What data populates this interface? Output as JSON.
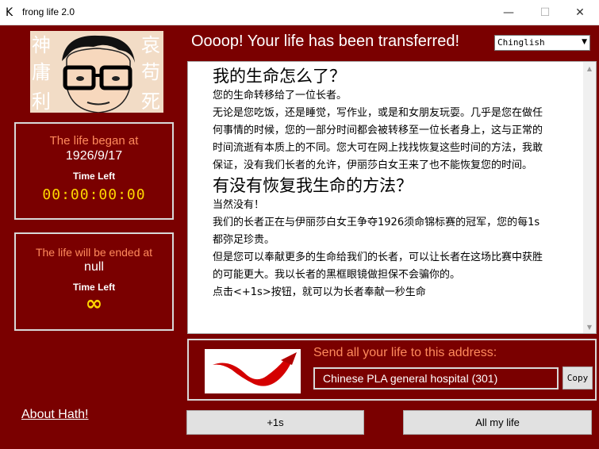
{
  "window": {
    "app_icon_glyph": "K",
    "title": "frong life 2.0",
    "min_glyph": "—",
    "max_glyph": "☐",
    "close_glyph": "✕"
  },
  "headline": "Oooop! Your life has been transferred!",
  "language": {
    "selected": "Chinglish",
    "arrow_glyph": "▼"
  },
  "began": {
    "label": "The life began at",
    "value": "1926/9/17",
    "time_left_label": "Time Left",
    "timer": "00:00:00:00"
  },
  "ended": {
    "label": "The life will be ended at",
    "value": "null",
    "time_left_label": "Time Left",
    "timer": "∞"
  },
  "avatar_chars": [
    "神",
    "庸",
    "利",
    "哀",
    "苟",
    "死"
  ],
  "content": {
    "h1": "我的生命怎么了？",
    "p1": "您的生命转移给了一位长者。",
    "p2": "无论是您吃饭，还是睡觉，写作业，或是和女朋友玩耍。几乎是您在做任何事情的时候，您的一部分时间都会被转移至一位长者身上，这与正常的时间流逝有本质上的不同。您大可在网上找找恢复这些时间的方法，我敢保证，没有我们长者的允许，伊丽莎白女王来了也不能恢复您的时间。",
    "h2": "有没有恢复我生命的方法？",
    "p3": "当然没有！",
    "p4": "我们的长者正在与伊丽莎白女王争夺1926须命锦标赛的冠军，您的每1s都弥足珍贵。",
    "p5": "但是您可以奉献更多的生命给我们的长者，可以让长者在这场比赛中获胜的可能更大。我以长者的黑框眼镜做担保不会骗你的。",
    "p6": "点击<+1s>按钮，就可以为长者奉献一秒生命"
  },
  "scroll": {
    "up_glyph": "▲",
    "down_glyph": "▼"
  },
  "send": {
    "label": "Send all your life to this address:",
    "address": "Chinese PLA general hospital (301)",
    "copy_label": "Copy"
  },
  "about_label": "About Hath!",
  "buttons": {
    "plus_label": "+1s",
    "all_label": "All my life"
  },
  "colors": {
    "background": "#7a0000",
    "accent_orange": "#ff8a5c",
    "timer_yellow": "#ffd700",
    "ribbon_red": "#d40000"
  }
}
